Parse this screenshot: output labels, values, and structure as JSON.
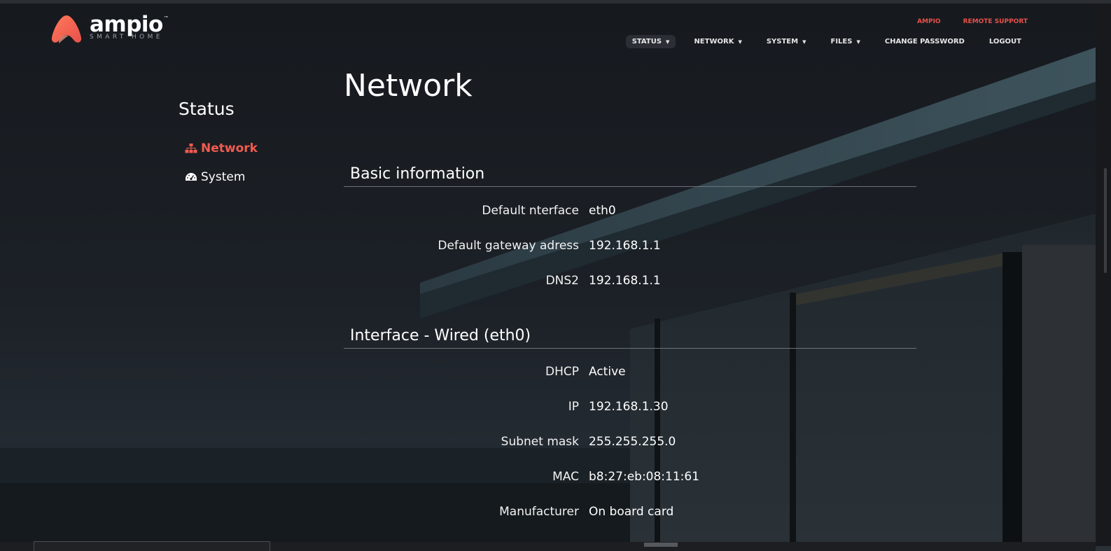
{
  "brand": {
    "name": "ampio",
    "trademark": "™",
    "tagline": "SMART HOME",
    "accent_color": "#f25b4f",
    "logo_icon": "ampio-logo-icon"
  },
  "top_links": [
    "AMPIO",
    "REMOTE SUPPORT"
  ],
  "nav": [
    {
      "label": "STATUS",
      "dropdown": true,
      "active": true
    },
    {
      "label": "NETWORK",
      "dropdown": true,
      "active": false
    },
    {
      "label": "SYSTEM",
      "dropdown": true,
      "active": false
    },
    {
      "label": "FILES",
      "dropdown": true,
      "active": false
    },
    {
      "label": "CHANGE PASSWORD",
      "dropdown": false,
      "active": false
    },
    {
      "label": "LOGOUT",
      "dropdown": false,
      "active": false
    }
  ],
  "sidebar": {
    "title": "Status",
    "items": [
      {
        "label": "Network",
        "icon": "sitemap-icon",
        "active": true
      },
      {
        "label": "System",
        "icon": "dashboard-icon",
        "active": false
      }
    ]
  },
  "page_title": "Network",
  "sections": [
    {
      "title": "Basic information",
      "rows": [
        {
          "label": "Default nterface",
          "value": "eth0"
        },
        {
          "label": "Default gateway adress",
          "value": "192.168.1.1"
        },
        {
          "label": "DNS2",
          "value": "192.168.1.1"
        }
      ]
    },
    {
      "title": "Interface - Wired (eth0)",
      "rows": [
        {
          "label": "DHCP",
          "value": "Active"
        },
        {
          "label": "IP",
          "value": "192.168.1.30"
        },
        {
          "label": "Subnet mask",
          "value": "255.255.255.0"
        },
        {
          "label": "MAC",
          "value": "b8:27:eb:08:11:61"
        },
        {
          "label": "Manufacturer",
          "value": "On board card"
        }
      ]
    }
  ]
}
